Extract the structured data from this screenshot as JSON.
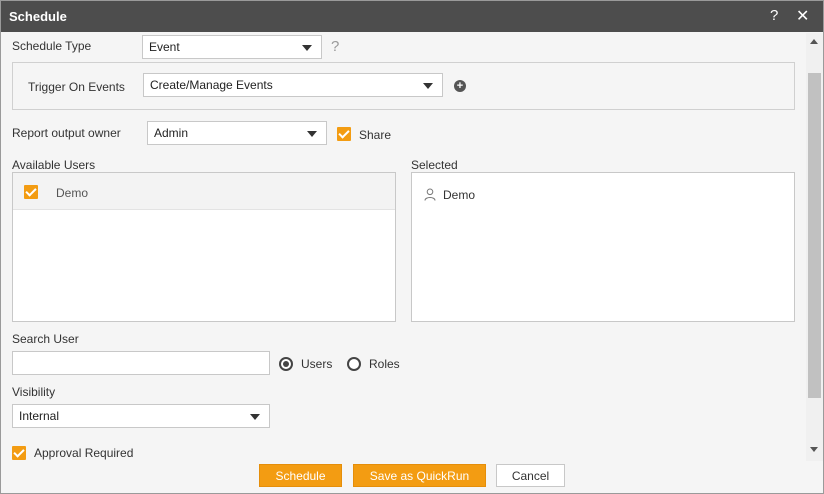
{
  "dialog": {
    "title": "Schedule",
    "help_glyph": "?",
    "close_glyph": "✕"
  },
  "schedule_type": {
    "label": "Schedule Type",
    "value": "Event",
    "help_glyph": "?"
  },
  "trigger": {
    "label": "Trigger On Events",
    "value": "Create/Manage Events"
  },
  "owner": {
    "label": "Report output owner",
    "value": "Admin",
    "share_label": "Share",
    "share_checked": true
  },
  "available_users": {
    "label": "Available Users",
    "items": [
      {
        "name": "Demo",
        "checked": true
      }
    ]
  },
  "selected_users": {
    "label": "Selected",
    "items": [
      {
        "name": "Demo"
      }
    ]
  },
  "search": {
    "label": "Search User",
    "value": "",
    "radio_users": "Users",
    "radio_roles": "Roles",
    "selected_mode": "Users"
  },
  "visibility": {
    "label": "Visibility",
    "value": "Internal"
  },
  "approval": {
    "label": "Approval Required",
    "checked": true
  },
  "buttons": {
    "schedule": "Schedule",
    "quickrun": "Save as QuickRun",
    "cancel": "Cancel"
  },
  "colors": {
    "accent": "#f39c12",
    "titlebar": "#4d4d4d"
  }
}
